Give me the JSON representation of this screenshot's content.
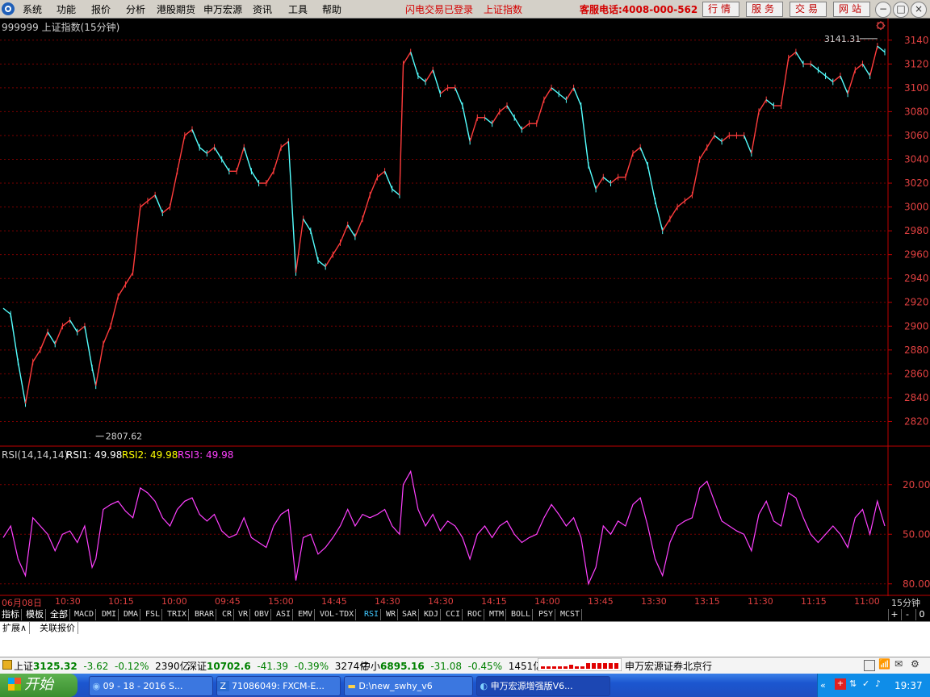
{
  "menubar": {
    "items": [
      "系统",
      "功能",
      "报价",
      "分析",
      "港股期货",
      "申万宏源",
      "资讯",
      "工具",
      "帮助"
    ],
    "status_text": "闪电交易已登录",
    "index_name": "上证指数",
    "hotline": "客服电话:4008-000-562",
    "buttons": [
      "行情",
      "服务",
      "交易",
      "网站"
    ]
  },
  "chart": {
    "title": "999999 上证指数(15分钟)",
    "high_label": "3141.31",
    "low_label": "2807.62",
    "y_ticks": [
      "3140",
      "3120",
      "3100",
      "3080",
      "3060",
      "3040",
      "3020",
      "3000",
      "2980",
      "2960",
      "2940",
      "2920",
      "2900",
      "2880",
      "2860",
      "2840",
      "2820"
    ],
    "colors": {
      "up": "#ff3c3c",
      "down": "#54ffff",
      "grid": "#7a0000",
      "axis": "#c00000",
      "axis_text": "#e04040"
    }
  },
  "chart_data": [
    {
      "type": "candlestick",
      "title": "999999 上证指数(15分钟)",
      "ylim": [
        2800,
        3150
      ],
      "y_unit": "index points",
      "annotations": [
        {
          "label": "3141.31",
          "kind": "period-high"
        },
        {
          "label": "2807.62",
          "kind": "period-low"
        }
      ],
      "path_points": [
        {
          "x": 0,
          "y": 2915
        },
        {
          "x": 4,
          "y": 2910
        },
        {
          "x": 8,
          "y": 2870
        },
        {
          "x": 12,
          "y": 2835
        },
        {
          "x": 16,
          "y": 2870
        },
        {
          "x": 20,
          "y": 2880
        },
        {
          "x": 24,
          "y": 2895
        },
        {
          "x": 28,
          "y": 2885
        },
        {
          "x": 32,
          "y": 2900
        },
        {
          "x": 36,
          "y": 2905
        },
        {
          "x": 40,
          "y": 2895
        },
        {
          "x": 44,
          "y": 2900
        },
        {
          "x": 48,
          "y": 2865
        },
        {
          "x": 50,
          "y": 2850
        },
        {
          "x": 54,
          "y": 2885
        },
        {
          "x": 58,
          "y": 2900
        },
        {
          "x": 62,
          "y": 2925
        },
        {
          "x": 66,
          "y": 2935
        },
        {
          "x": 70,
          "y": 2945
        },
        {
          "x": 74,
          "y": 3000
        },
        {
          "x": 78,
          "y": 3005
        },
        {
          "x": 82,
          "y": 3010
        },
        {
          "x": 86,
          "y": 2995
        },
        {
          "x": 90,
          "y": 3000
        },
        {
          "x": 94,
          "y": 3030
        },
        {
          "x": 98,
          "y": 3060
        },
        {
          "x": 102,
          "y": 3065
        },
        {
          "x": 106,
          "y": 3050
        },
        {
          "x": 110,
          "y": 3045
        },
        {
          "x": 114,
          "y": 3050
        },
        {
          "x": 118,
          "y": 3040
        },
        {
          "x": 122,
          "y": 3030
        },
        {
          "x": 126,
          "y": 3030
        },
        {
          "x": 130,
          "y": 3050
        },
        {
          "x": 134,
          "y": 3030
        },
        {
          "x": 138,
          "y": 3020
        },
        {
          "x": 142,
          "y": 3020
        },
        {
          "x": 146,
          "y": 3030
        },
        {
          "x": 150,
          "y": 3050
        },
        {
          "x": 154,
          "y": 3055
        },
        {
          "x": 158,
          "y": 2945
        },
        {
          "x": 162,
          "y": 2990
        },
        {
          "x": 166,
          "y": 2980
        },
        {
          "x": 170,
          "y": 2955
        },
        {
          "x": 174,
          "y": 2950
        },
        {
          "x": 178,
          "y": 2960
        },
        {
          "x": 182,
          "y": 2970
        },
        {
          "x": 186,
          "y": 2985
        },
        {
          "x": 190,
          "y": 2975
        },
        {
          "x": 194,
          "y": 2990
        },
        {
          "x": 198,
          "y": 3010
        },
        {
          "x": 202,
          "y": 3025
        },
        {
          "x": 206,
          "y": 3030
        },
        {
          "x": 210,
          "y": 3015
        },
        {
          "x": 214,
          "y": 3010
        },
        {
          "x": 216,
          "y": 3120
        },
        {
          "x": 220,
          "y": 3130
        },
        {
          "x": 224,
          "y": 3110
        },
        {
          "x": 228,
          "y": 3105
        },
        {
          "x": 232,
          "y": 3115
        },
        {
          "x": 236,
          "y": 3095
        },
        {
          "x": 240,
          "y": 3100
        },
        {
          "x": 244,
          "y": 3100
        },
        {
          "x": 248,
          "y": 3085
        },
        {
          "x": 252,
          "y": 3055
        },
        {
          "x": 256,
          "y": 3075
        },
        {
          "x": 260,
          "y": 3075
        },
        {
          "x": 264,
          "y": 3070
        },
        {
          "x": 268,
          "y": 3080
        },
        {
          "x": 272,
          "y": 3085
        },
        {
          "x": 276,
          "y": 3075
        },
        {
          "x": 280,
          "y": 3065
        },
        {
          "x": 284,
          "y": 3070
        },
        {
          "x": 288,
          "y": 3070
        },
        {
          "x": 292,
          "y": 3090
        },
        {
          "x": 296,
          "y": 3100
        },
        {
          "x": 300,
          "y": 3095
        },
        {
          "x": 304,
          "y": 3090
        },
        {
          "x": 308,
          "y": 3100
        },
        {
          "x": 312,
          "y": 3085
        },
        {
          "x": 316,
          "y": 3035
        },
        {
          "x": 320,
          "y": 3015
        },
        {
          "x": 324,
          "y": 3025
        },
        {
          "x": 328,
          "y": 3020
        },
        {
          "x": 332,
          "y": 3025
        },
        {
          "x": 336,
          "y": 3025
        },
        {
          "x": 340,
          "y": 3045
        },
        {
          "x": 344,
          "y": 3050
        },
        {
          "x": 348,
          "y": 3035
        },
        {
          "x": 352,
          "y": 3005
        },
        {
          "x": 356,
          "y": 2980
        },
        {
          "x": 360,
          "y": 2990
        },
        {
          "x": 364,
          "y": 3000
        },
        {
          "x": 368,
          "y": 3005
        },
        {
          "x": 372,
          "y": 3010
        },
        {
          "x": 376,
          "y": 3040
        },
        {
          "x": 380,
          "y": 3050
        },
        {
          "x": 384,
          "y": 3060
        },
        {
          "x": 388,
          "y": 3055
        },
        {
          "x": 392,
          "y": 3060
        },
        {
          "x": 396,
          "y": 3060
        },
        {
          "x": 400,
          "y": 3060
        },
        {
          "x": 404,
          "y": 3045
        },
        {
          "x": 408,
          "y": 3080
        },
        {
          "x": 412,
          "y": 3090
        },
        {
          "x": 416,
          "y": 3085
        },
        {
          "x": 420,
          "y": 3085
        },
        {
          "x": 424,
          "y": 3125
        },
        {
          "x": 428,
          "y": 3130
        },
        {
          "x": 432,
          "y": 3120
        },
        {
          "x": 436,
          "y": 3120
        },
        {
          "x": 440,
          "y": 3115
        },
        {
          "x": 444,
          "y": 3110
        },
        {
          "x": 448,
          "y": 3105
        },
        {
          "x": 452,
          "y": 3110
        },
        {
          "x": 456,
          "y": 3095
        },
        {
          "x": 460,
          "y": 3115
        },
        {
          "x": 464,
          "y": 3120
        },
        {
          "x": 468,
          "y": 3110
        },
        {
          "x": 472,
          "y": 3135
        },
        {
          "x": 476,
          "y": 3130
        }
      ]
    },
    {
      "type": "line",
      "title": "RSI(14,14,14)",
      "ylim": [
        15,
        95
      ],
      "y_ticks": [
        20,
        50,
        80
      ],
      "series": [
        {
          "name": "RSI1",
          "value": "49.98"
        },
        {
          "name": "RSI2",
          "value": "49.98"
        },
        {
          "name": "RSI3",
          "value": "49.98"
        }
      ],
      "colors": {
        "RSI1": "#ffffff",
        "RSI2": "#ffff00",
        "RSI3": "#ff40ff"
      },
      "path_points": [
        {
          "x": 0,
          "y": 48
        },
        {
          "x": 4,
          "y": 55
        },
        {
          "x": 8,
          "y": 35
        },
        {
          "x": 12,
          "y": 25
        },
        {
          "x": 16,
          "y": 60
        },
        {
          "x": 20,
          "y": 55
        },
        {
          "x": 24,
          "y": 50
        },
        {
          "x": 28,
          "y": 40
        },
        {
          "x": 32,
          "y": 50
        },
        {
          "x": 36,
          "y": 52
        },
        {
          "x": 40,
          "y": 45
        },
        {
          "x": 44,
          "y": 55
        },
        {
          "x": 48,
          "y": 30
        },
        {
          "x": 50,
          "y": 35
        },
        {
          "x": 54,
          "y": 65
        },
        {
          "x": 58,
          "y": 68
        },
        {
          "x": 62,
          "y": 70
        },
        {
          "x": 66,
          "y": 64
        },
        {
          "x": 70,
          "y": 60
        },
        {
          "x": 74,
          "y": 78
        },
        {
          "x": 78,
          "y": 75
        },
        {
          "x": 82,
          "y": 70
        },
        {
          "x": 86,
          "y": 60
        },
        {
          "x": 90,
          "y": 55
        },
        {
          "x": 94,
          "y": 65
        },
        {
          "x": 98,
          "y": 70
        },
        {
          "x": 102,
          "y": 72
        },
        {
          "x": 106,
          "y": 62
        },
        {
          "x": 110,
          "y": 58
        },
        {
          "x": 114,
          "y": 62
        },
        {
          "x": 118,
          "y": 52
        },
        {
          "x": 122,
          "y": 48
        },
        {
          "x": 126,
          "y": 50
        },
        {
          "x": 130,
          "y": 60
        },
        {
          "x": 134,
          "y": 48
        },
        {
          "x": 138,
          "y": 45
        },
        {
          "x": 142,
          "y": 42
        },
        {
          "x": 146,
          "y": 55
        },
        {
          "x": 150,
          "y": 62
        },
        {
          "x": 154,
          "y": 65
        },
        {
          "x": 158,
          "y": 22
        },
        {
          "x": 162,
          "y": 48
        },
        {
          "x": 166,
          "y": 50
        },
        {
          "x": 170,
          "y": 38
        },
        {
          "x": 174,
          "y": 42
        },
        {
          "x": 178,
          "y": 48
        },
        {
          "x": 182,
          "y": 55
        },
        {
          "x": 186,
          "y": 65
        },
        {
          "x": 190,
          "y": 55
        },
        {
          "x": 194,
          "y": 62
        },
        {
          "x": 198,
          "y": 60
        },
        {
          "x": 202,
          "y": 62
        },
        {
          "x": 206,
          "y": 65
        },
        {
          "x": 210,
          "y": 55
        },
        {
          "x": 214,
          "y": 50
        },
        {
          "x": 216,
          "y": 80
        },
        {
          "x": 220,
          "y": 88
        },
        {
          "x": 224,
          "y": 65
        },
        {
          "x": 228,
          "y": 55
        },
        {
          "x": 232,
          "y": 62
        },
        {
          "x": 236,
          "y": 52
        },
        {
          "x": 240,
          "y": 58
        },
        {
          "x": 244,
          "y": 55
        },
        {
          "x": 248,
          "y": 48
        },
        {
          "x": 252,
          "y": 35
        },
        {
          "x": 256,
          "y": 50
        },
        {
          "x": 260,
          "y": 55
        },
        {
          "x": 264,
          "y": 48
        },
        {
          "x": 268,
          "y": 55
        },
        {
          "x": 272,
          "y": 58
        },
        {
          "x": 276,
          "y": 50
        },
        {
          "x": 280,
          "y": 45
        },
        {
          "x": 284,
          "y": 48
        },
        {
          "x": 288,
          "y": 50
        },
        {
          "x": 292,
          "y": 60
        },
        {
          "x": 296,
          "y": 68
        },
        {
          "x": 300,
          "y": 62
        },
        {
          "x": 304,
          "y": 55
        },
        {
          "x": 308,
          "y": 60
        },
        {
          "x": 312,
          "y": 48
        },
        {
          "x": 316,
          "y": 20
        },
        {
          "x": 320,
          "y": 30
        },
        {
          "x": 324,
          "y": 55
        },
        {
          "x": 328,
          "y": 50
        },
        {
          "x": 332,
          "y": 58
        },
        {
          "x": 336,
          "y": 55
        },
        {
          "x": 340,
          "y": 68
        },
        {
          "x": 344,
          "y": 72
        },
        {
          "x": 348,
          "y": 55
        },
        {
          "x": 352,
          "y": 35
        },
        {
          "x": 356,
          "y": 25
        },
        {
          "x": 360,
          "y": 45
        },
        {
          "x": 364,
          "y": 55
        },
        {
          "x": 368,
          "y": 58
        },
        {
          "x": 372,
          "y": 60
        },
        {
          "x": 376,
          "y": 78
        },
        {
          "x": 380,
          "y": 82
        },
        {
          "x": 384,
          "y": 70
        },
        {
          "x": 388,
          "y": 58
        },
        {
          "x": 392,
          "y": 55
        },
        {
          "x": 396,
          "y": 52
        },
        {
          "x": 400,
          "y": 50
        },
        {
          "x": 404,
          "y": 40
        },
        {
          "x": 408,
          "y": 62
        },
        {
          "x": 412,
          "y": 70
        },
        {
          "x": 416,
          "y": 58
        },
        {
          "x": 420,
          "y": 55
        },
        {
          "x": 424,
          "y": 75
        },
        {
          "x": 428,
          "y": 72
        },
        {
          "x": 432,
          "y": 60
        },
        {
          "x": 436,
          "y": 50
        },
        {
          "x": 440,
          "y": 45
        },
        {
          "x": 444,
          "y": 50
        },
        {
          "x": 448,
          "y": 55
        },
        {
          "x": 452,
          "y": 50
        },
        {
          "x": 456,
          "y": 42
        },
        {
          "x": 460,
          "y": 60
        },
        {
          "x": 464,
          "y": 65
        },
        {
          "x": 468,
          "y": 50
        },
        {
          "x": 472,
          "y": 70
        },
        {
          "x": 476,
          "y": 55
        }
      ]
    }
  ],
  "rsi": {
    "title": "RSI(14,14,14)",
    "rsi1_label": "RSI1: 49.98",
    "rsi2_label": "RSI2: 49.98",
    "rsi3_label": "RSI3: 49.98",
    "y_ticks": [
      "80.00",
      "50.00",
      "20.00"
    ]
  },
  "date_axis": {
    "labels": [
      "06月08日",
      "10:30",
      "10:15",
      "10:00",
      "09:45",
      "15:00",
      "14:45",
      "14:30",
      "14:30",
      "14:15",
      "14:00",
      "13:45",
      "13:30",
      "13:15",
      "11:30",
      "11:15",
      "11:00"
    ],
    "period": "15分钟"
  },
  "indicator_tabs": [
    "指标",
    "模板",
    "全部",
    "MACD",
    "DMI",
    "DMA",
    "FSL",
    "TRIX",
    "BRAR",
    "CR",
    "VR",
    "OBV",
    "ASI",
    "EMV",
    "VOL-TDX",
    "RSI",
    "WR",
    "SAR",
    "KDJ",
    "CCI",
    "ROC",
    "MTM",
    "BOLL",
    "PSY",
    "MCST"
  ],
  "active_tab": "RSI",
  "small_buttons": [
    "+",
    "-",
    "0"
  ],
  "extension_tabs": [
    "扩展∧",
    "关联报价"
  ],
  "status": {
    "sh_name": "上证",
    "sh_price": "3125.32",
    "sh_change": "-3.62",
    "sh_pct": "-0.12%",
    "sh_amount": "2390亿",
    "sz_name": "深证",
    "sz_price": "10702.6",
    "sz_change": "-41.39",
    "sz_pct": "-0.39%",
    "sz_amount": "3274亿",
    "zx_name": "中小",
    "zx_price": "6895.16",
    "zx_change": "-31.08",
    "zx_pct": "-0.45%",
    "zx_amount": "1451亿",
    "broker": "申万宏源证券北京行"
  },
  "taskbar": {
    "start_label": "开始",
    "tasks": [
      "09 - 18 - 2016 S...",
      "71086049: FXCM-E...",
      "D:\\new_swhy_v6",
      "申万宏源增强版V6..."
    ],
    "clock": "19:37"
  }
}
